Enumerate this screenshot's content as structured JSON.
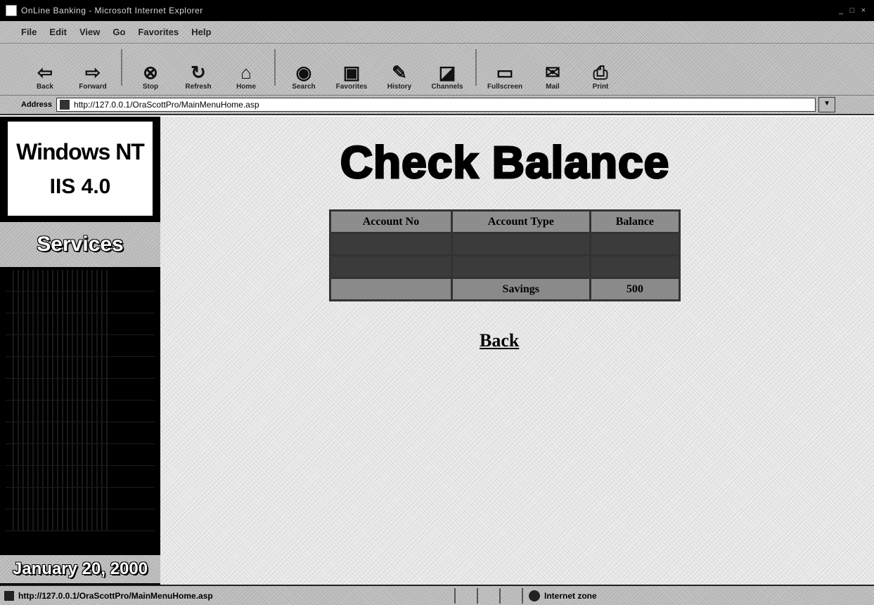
{
  "window": {
    "title": "OnLine Banking - Microsoft Internet Explorer",
    "controls": [
      "_",
      "□",
      "×"
    ]
  },
  "menubar": {
    "items": [
      "File",
      "Edit",
      "View",
      "Go",
      "Favorites",
      "Help"
    ]
  },
  "toolbar": {
    "buttons": [
      {
        "label": "Back",
        "icon": "back-arrow-icon"
      },
      {
        "label": "Forward",
        "icon": "forward-arrow-icon"
      },
      {
        "label": "Stop",
        "icon": "stop-icon"
      },
      {
        "label": "Refresh",
        "icon": "refresh-icon"
      },
      {
        "label": "Home",
        "icon": "home-icon"
      },
      {
        "label": "Search",
        "icon": "search-icon"
      },
      {
        "label": "Favorites",
        "icon": "favorites-icon"
      },
      {
        "label": "History",
        "icon": "history-icon"
      },
      {
        "label": "Channels",
        "icon": "channels-icon"
      },
      {
        "label": "Fullscreen",
        "icon": "fullscreen-icon"
      },
      {
        "label": "Mail",
        "icon": "mail-icon"
      },
      {
        "label": "Print",
        "icon": "print-icon"
      }
    ]
  },
  "address": {
    "label": "Address",
    "url": "http://127.0.0.1/OraScottPro/MainMenuHome.asp"
  },
  "sidebar": {
    "brand_line1": "Windows NT",
    "brand_line2": "IIS 4.0",
    "services_title": "Services",
    "nav_item_count": 12,
    "date": "January 20, 2000"
  },
  "main": {
    "heading": "Check Balance",
    "table": {
      "headers": [
        "Account No",
        "Account Type",
        "Balance"
      ],
      "rows": [
        [
          "",
          "",
          ""
        ],
        [
          "",
          "",
          ""
        ],
        [
          "",
          "Savings",
          "500"
        ]
      ]
    },
    "back_link": "Back"
  },
  "statusbar": {
    "url": "http://127.0.0.1/OraScottPro/MainMenuHome.asp",
    "zone": "Internet zone"
  }
}
